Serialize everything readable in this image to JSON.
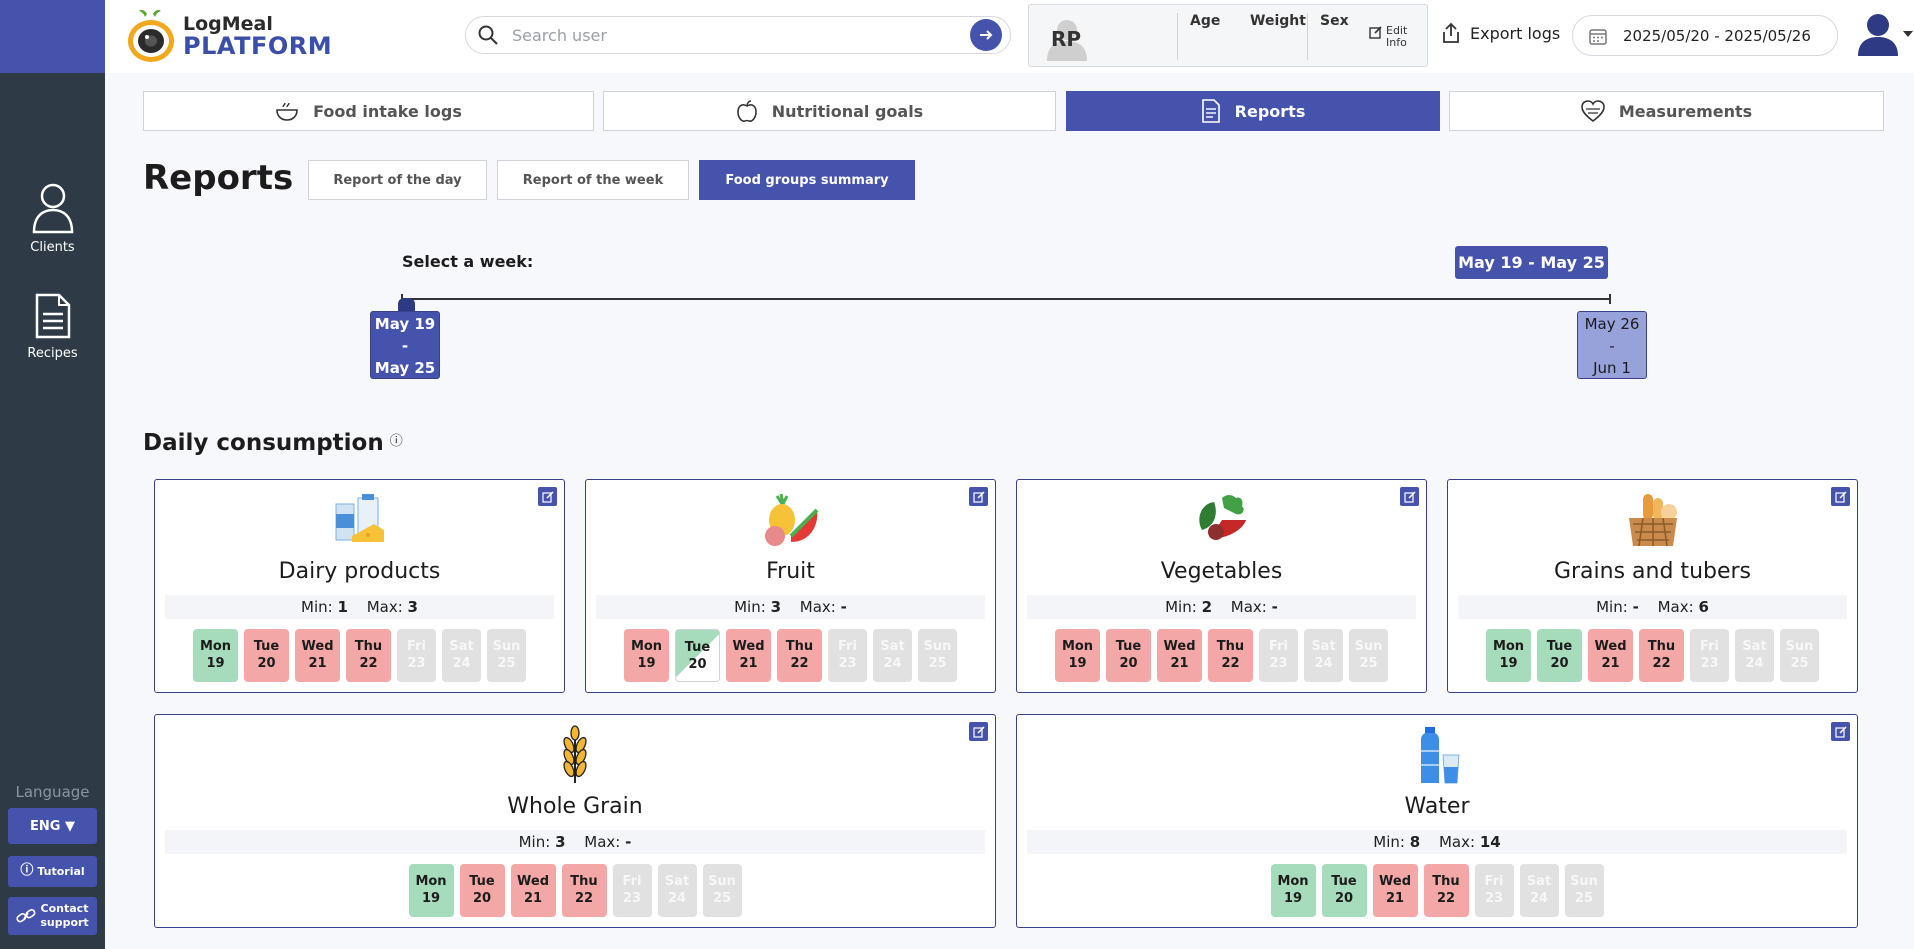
{
  "app": {
    "name_line1": "LogMeal",
    "name_line2": "PLATFORM"
  },
  "sidebar": {
    "items": [
      {
        "label": "Clients",
        "icon": "user-icon"
      },
      {
        "label": "Recipes",
        "icon": "document-icon"
      }
    ],
    "language_label": "Language",
    "language_button": "ENG ▼",
    "tutorial": "Tutorial",
    "contact_line1": "Contact",
    "contact_line2": "support"
  },
  "header": {
    "search_placeholder": "Search user",
    "user_initials": "RP",
    "col_age": "Age",
    "col_weight": "Weight",
    "col_sex": "Sex",
    "edit_line1": "Edit",
    "edit_line2": "Info",
    "export_label": "Export logs",
    "date_range": "2025/05/20 - 2025/05/26"
  },
  "tabs": [
    {
      "label": "Food intake logs",
      "icon": "food-bowl-icon"
    },
    {
      "label": "Nutritional goals",
      "icon": "apple-icon"
    },
    {
      "label": "Reports",
      "icon": "report-icon"
    },
    {
      "label": "Measurements",
      "icon": "measurement-icon"
    }
  ],
  "reports": {
    "title": "Reports",
    "subtabs": [
      "Report of the day",
      "Report of the week",
      "Food groups summary"
    ],
    "active_subtab": "Food groups summary"
  },
  "week": {
    "select_label": "Select a week:",
    "selected_badge": "May 19 - May 25",
    "options": [
      {
        "line1": "May 19",
        "line2": "-",
        "line3": "May 25"
      },
      {
        "line1": "May 26",
        "line2": "-",
        "line3": "Jun 1"
      }
    ]
  },
  "daily": {
    "title": "Daily consumption",
    "info_icon": "ⓘ",
    "min_label": "Min:",
    "max_label": "Max:",
    "colors": {
      "ok": "#a6dbbb",
      "bad": "#f4a7a7",
      "future": "#e1e1e1",
      "accent": "#4653ad"
    },
    "groups": [
      {
        "name": "Dairy products",
        "icon": "dairy-icon",
        "min": "1",
        "max": "3",
        "days": [
          {
            "d": "Mon",
            "n": "19",
            "s": "ok"
          },
          {
            "d": "Tue",
            "n": "20",
            "s": "bad"
          },
          {
            "d": "Wed",
            "n": "21",
            "s": "bad"
          },
          {
            "d": "Thu",
            "n": "22",
            "s": "bad"
          },
          {
            "d": "Fri",
            "n": "23",
            "s": "future"
          },
          {
            "d": "Sat",
            "n": "24",
            "s": "future"
          },
          {
            "d": "Sun",
            "n": "25",
            "s": "future"
          }
        ]
      },
      {
        "name": "Fruit",
        "icon": "fruit-icon",
        "min": "3",
        "max": "-",
        "days": [
          {
            "d": "Mon",
            "n": "19",
            "s": "bad"
          },
          {
            "d": "Tue",
            "n": "20",
            "s": "split"
          },
          {
            "d": "Wed",
            "n": "21",
            "s": "bad"
          },
          {
            "d": "Thu",
            "n": "22",
            "s": "bad"
          },
          {
            "d": "Fri",
            "n": "23",
            "s": "future"
          },
          {
            "d": "Sat",
            "n": "24",
            "s": "future"
          },
          {
            "d": "Sun",
            "n": "25",
            "s": "future"
          }
        ]
      },
      {
        "name": "Vegetables",
        "icon": "vegetables-icon",
        "min": "2",
        "max": "-",
        "days": [
          {
            "d": "Mon",
            "n": "19",
            "s": "bad"
          },
          {
            "d": "Tue",
            "n": "20",
            "s": "bad"
          },
          {
            "d": "Wed",
            "n": "21",
            "s": "bad"
          },
          {
            "d": "Thu",
            "n": "22",
            "s": "bad"
          },
          {
            "d": "Fri",
            "n": "23",
            "s": "future"
          },
          {
            "d": "Sat",
            "n": "24",
            "s": "future"
          },
          {
            "d": "Sun",
            "n": "25",
            "s": "future"
          }
        ]
      },
      {
        "name": "Grains and tubers",
        "icon": "bread-basket-icon",
        "min": "-",
        "max": "6",
        "days": [
          {
            "d": "Mon",
            "n": "19",
            "s": "ok"
          },
          {
            "d": "Tue",
            "n": "20",
            "s": "ok"
          },
          {
            "d": "Wed",
            "n": "21",
            "s": "bad"
          },
          {
            "d": "Thu",
            "n": "22",
            "s": "bad"
          },
          {
            "d": "Fri",
            "n": "23",
            "s": "future"
          },
          {
            "d": "Sat",
            "n": "24",
            "s": "future"
          },
          {
            "d": "Sun",
            "n": "25",
            "s": "future"
          }
        ]
      },
      {
        "name": "Whole Grain",
        "icon": "wheat-icon",
        "min": "3",
        "max": "-",
        "days": [
          {
            "d": "Mon",
            "n": "19",
            "s": "ok"
          },
          {
            "d": "Tue",
            "n": "20",
            "s": "bad"
          },
          {
            "d": "Wed",
            "n": "21",
            "s": "bad"
          },
          {
            "d": "Thu",
            "n": "22",
            "s": "bad"
          },
          {
            "d": "Fri",
            "n": "23",
            "s": "future"
          },
          {
            "d": "Sat",
            "n": "24",
            "s": "future"
          },
          {
            "d": "Sun",
            "n": "25",
            "s": "future"
          }
        ]
      },
      {
        "name": "Water",
        "icon": "water-icon",
        "min": "8",
        "max": "14",
        "days": [
          {
            "d": "Mon",
            "n": "19",
            "s": "ok"
          },
          {
            "d": "Tue",
            "n": "20",
            "s": "ok"
          },
          {
            "d": "Wed",
            "n": "21",
            "s": "bad"
          },
          {
            "d": "Thu",
            "n": "22",
            "s": "bad"
          },
          {
            "d": "Fri",
            "n": "23",
            "s": "future"
          },
          {
            "d": "Sat",
            "n": "24",
            "s": "future"
          },
          {
            "d": "Sun",
            "n": "25",
            "s": "future"
          }
        ]
      }
    ]
  }
}
